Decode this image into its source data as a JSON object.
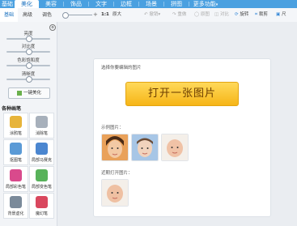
{
  "nav": {
    "tabs": [
      "美化",
      "美容",
      "饰品",
      "文字",
      "边框",
      "场景",
      "拼图",
      "更多功能"
    ]
  },
  "subtabs": [
    "基础",
    "高级",
    "调色"
  ],
  "toolbar": {
    "zoom_ratio": "1:1",
    "zoom_max": "原大",
    "undo": "撤销",
    "redo": "重做",
    "reset": "原图",
    "compare": "对比",
    "rotate": "旋转",
    "crop": "裁剪",
    "resize": "尺"
  },
  "left": {
    "sliders": [
      {
        "label": "亮度",
        "level": 0.5
      },
      {
        "label": "对比度",
        "level": 0.5
      },
      {
        "label": "色彩饱和度",
        "level": 0.5
      },
      {
        "label": "清晰度",
        "level": 0.5
      }
    ],
    "one_key": "一键美化",
    "section_title": "各种画笔",
    "tools": [
      {
        "label": "涂鸦笔",
        "icon": "brush-icon",
        "color": "#e7b43a"
      },
      {
        "label": "消除笔",
        "icon": "eraser-icon",
        "color": "#a7b0bb"
      },
      {
        "label": "抠图笔",
        "icon": "cutout-icon",
        "color": "#5a9ad6"
      },
      {
        "label": "局部马赛克",
        "icon": "mosaic-icon",
        "color": "#4b86d0"
      },
      {
        "label": "局部彩色笔",
        "icon": "color-pen-icon",
        "color": "#d94a8c"
      },
      {
        "label": "局部变色笔",
        "icon": "recolor-pen-icon",
        "color": "#58b25a"
      },
      {
        "label": "背景虚化",
        "icon": "blur-bg-icon",
        "color": "#7a8a9a"
      },
      {
        "label": "魔幻笔",
        "icon": "magic-pen-icon",
        "color": "#d9475e"
      }
    ]
  },
  "main": {
    "open_prompt": "选择你要编辑的图片",
    "open_button": "打开一张图片",
    "example_title": "示例图片：",
    "recent_title": "近期打开图片："
  },
  "colors": {
    "nav_blue": "#4aa0e0",
    "button_yellow": "#f6b517"
  }
}
